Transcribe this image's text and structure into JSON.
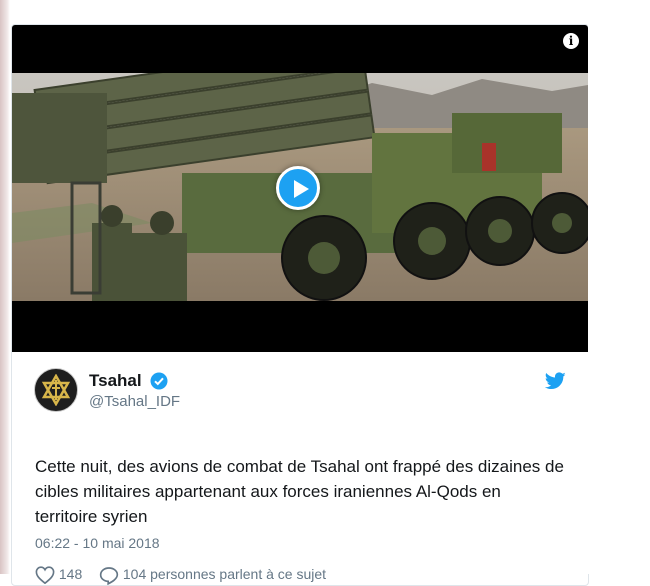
{
  "video": {
    "info_icon": "info-icon",
    "play_icon": "play-icon"
  },
  "tweet": {
    "author_name": "Tsahal",
    "handle": "@Tsahal_IDF",
    "verified": true,
    "text": "Cette nuit, des avions de combat de Tsahal ont frappé des dizaines de cibles militaires appartenant aux forces iraniennes Al-Qods en territoire syrien",
    "timestamp": "06:22 - 10 mai 2018",
    "likes": "148",
    "replies_text": "104 personnes parlent à ce sujet"
  },
  "colors": {
    "accent": "#1da1f2",
    "text": "#14171a",
    "muted": "#657786"
  }
}
